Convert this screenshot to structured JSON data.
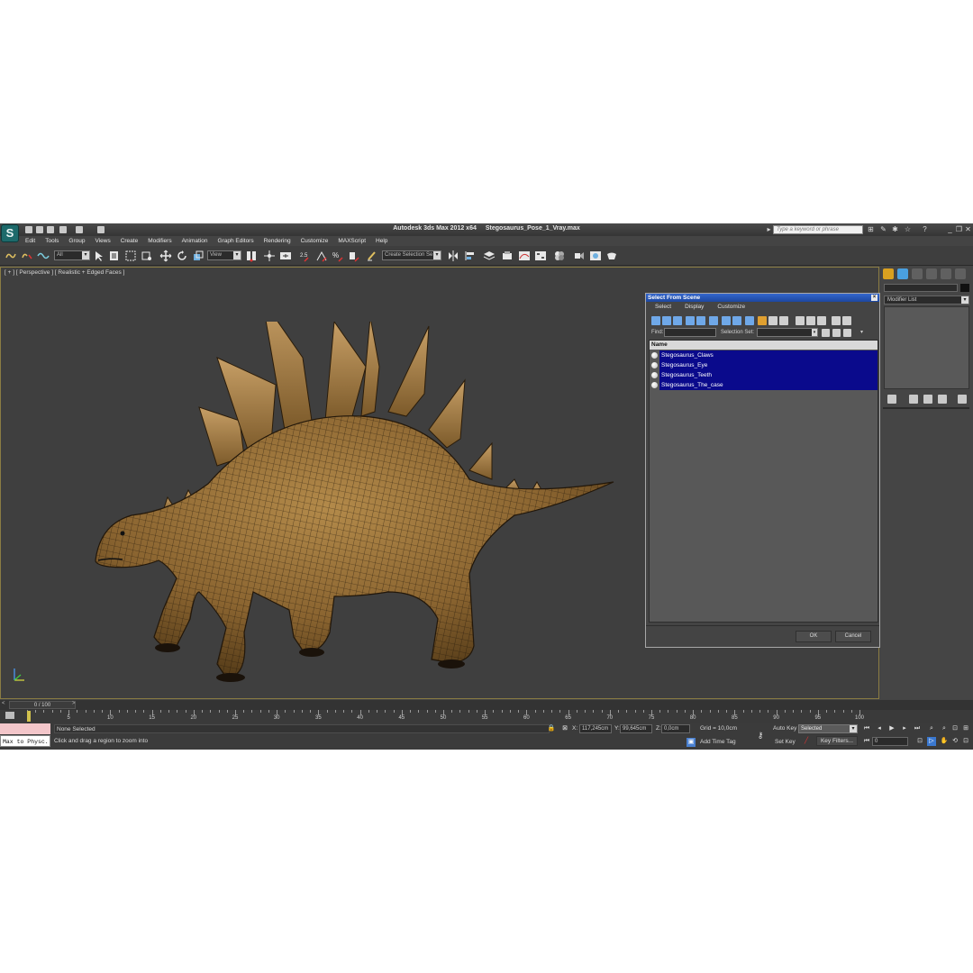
{
  "app": {
    "logo_glyph": "S",
    "title_parts": [
      "Autodesk 3ds Max  2012 x64",
      "Stegosaurus_Pose_1_Vray.max"
    ],
    "search_placeholder": "Type a keyword or phrase"
  },
  "menu": [
    "Edit",
    "Tools",
    "Group",
    "Views",
    "Create",
    "Modifiers",
    "Animation",
    "Graph Editors",
    "Rendering",
    "Customize",
    "MAXScript",
    "Help"
  ],
  "toolbar": {
    "selection_filter": "All",
    "reference_coord": "View",
    "snap_value": "2.5",
    "selection_set": "Create Selection Se"
  },
  "viewport": {
    "label": "[ + ] [ Perspective ] [ Realistic + Edged Faces ]",
    "border_color": "#8a7c43"
  },
  "command_panel": {
    "modifier_list": "Modifier List"
  },
  "dialog": {
    "title": "Select From Scene",
    "close_glyph": "×",
    "menus": [
      "Select",
      "Display",
      "Customize"
    ],
    "find_label": "Find:",
    "selection_set_label": "Selection Set:",
    "column_header": "Name",
    "items": [
      "Stegosaurus_Claws",
      "Stegosaurus_Eye",
      "Stegosaurus_Teeth",
      "Stegosaurus_The_case"
    ],
    "ok_label": "OK",
    "cancel_label": "Cancel",
    "highlight_color": "#0a0a8c"
  },
  "timeline": {
    "slider_label": "0 / 100",
    "ticks": [
      0,
      5,
      10,
      15,
      20,
      25,
      30,
      35,
      40,
      45,
      50,
      55,
      60,
      65,
      70,
      75,
      80,
      85,
      90,
      95,
      100
    ],
    "tick_labels": [
      "5",
      "10",
      "15",
      "20",
      "25",
      "30",
      "35",
      "40",
      "45",
      "50",
      "55",
      "60",
      "65",
      "70",
      "75",
      "80",
      "85",
      "90",
      "95",
      "100"
    ]
  },
  "status": {
    "maxscript_text": "Max to Physc.",
    "selection_text": "None Selected",
    "prompt_text": "Click and drag a region to zoom into",
    "x_label": "X:",
    "x_value": "117,245cm",
    "y_label": "Y:",
    "y_value": "99,645cm",
    "z_label": "Z:",
    "z_value": "0,0cm",
    "grid_text": "Grid = 10,0cm",
    "add_time_tag": "Add Time Tag",
    "auto_key": "Auto Key",
    "set_key": "Set Key",
    "selected_combo": "Selected",
    "key_filters": "Key Filters...",
    "frame_value": "0"
  }
}
